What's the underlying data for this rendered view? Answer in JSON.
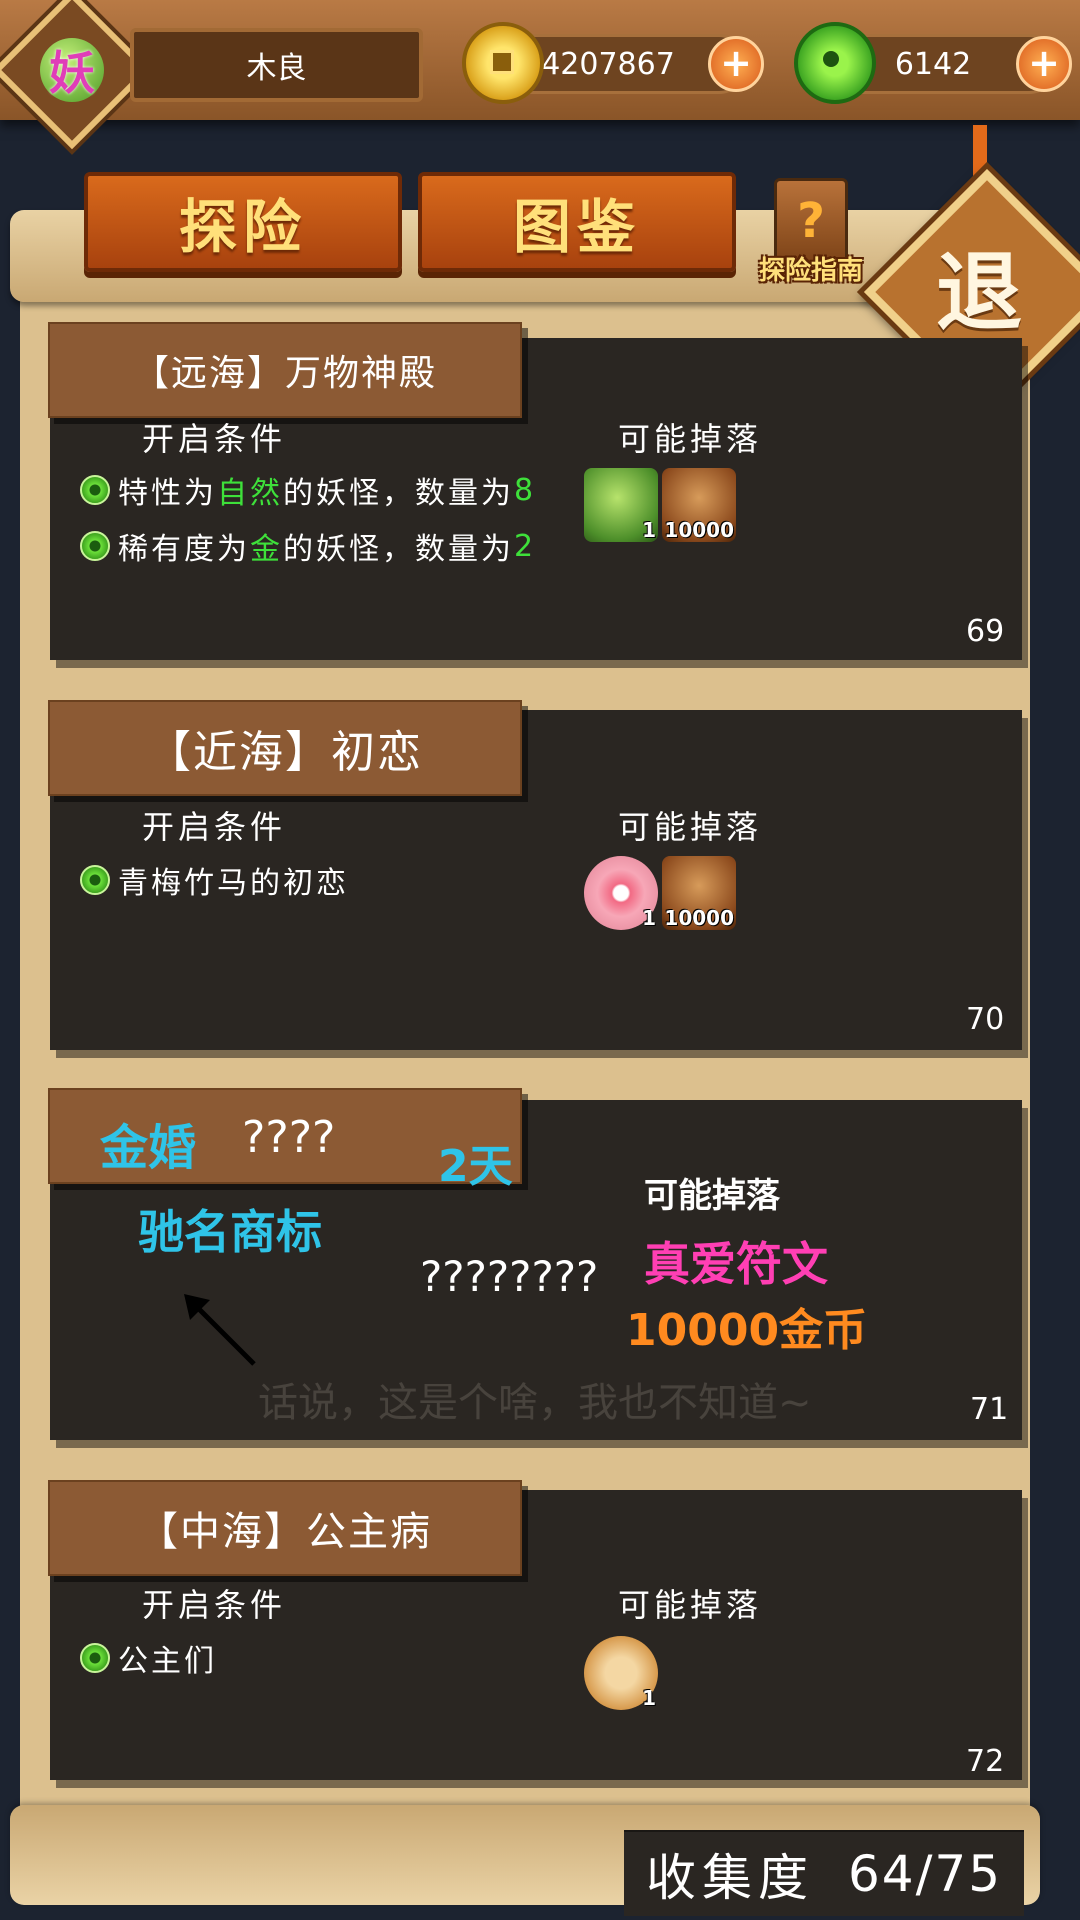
{
  "header": {
    "avatar_char": "妖",
    "player_name": "木良",
    "coins": "4207867",
    "jade": "6142",
    "plus_symbol": "+"
  },
  "tabs": [
    {
      "label": "探险",
      "active": true
    },
    {
      "label": "图鉴",
      "active": false
    }
  ],
  "guide": {
    "icon_char": "?",
    "label": "探险指南"
  },
  "exit": {
    "label": "退"
  },
  "levels": [
    {
      "title": "【远海】万物神殿",
      "conditions_header": "开启条件",
      "drops_header": "可能掉落",
      "conditions": [
        {
          "pre": "特性为",
          "hl": "自然",
          "mid": "的妖怪，数量为",
          "num": "8"
        },
        {
          "pre": "稀有度为",
          "hl": "金",
          "mid": "的妖怪，数量为",
          "num": "2"
        }
      ],
      "drops": [
        {
          "icon": "green-orb-icon",
          "count": "1"
        },
        {
          "icon": "money-bag-icon",
          "count": "10000"
        }
      ],
      "number": "69"
    },
    {
      "title": "【近海】初恋",
      "conditions_header": "开启条件",
      "drops_header": "可能掉落",
      "conditions": [
        {
          "text": "青梅竹马的初恋"
        }
      ],
      "drops": [
        {
          "icon": "heart-orb-icon",
          "count": "1"
        },
        {
          "icon": "money-bag-icon",
          "count": "10000"
        }
      ],
      "number": "70"
    },
    {
      "title_cyan": "金婚",
      "title_unknown": "????",
      "days": "2天",
      "note_brand": "驰名商标",
      "conditions_unknown": "????????",
      "drops_header": "可能掉落",
      "drop_rune": "真爱符文",
      "drop_gold": "10000金币",
      "caption": "话说，这是个啥，我也不知道~",
      "number": "71"
    },
    {
      "title": "【中海】公主病",
      "conditions_header": "开启条件",
      "drops_header": "可能掉落",
      "conditions": [
        {
          "text": "公主们"
        }
      ],
      "drops": [
        {
          "icon": "fan-item-icon",
          "count": "1"
        }
      ],
      "number": "72"
    }
  ],
  "footer": {
    "collection_label": "收集度",
    "collection_value": "64/75"
  },
  "colors": {
    "highlight_green": "#3ee03a",
    "overlay_cyan": "#2fc4e8",
    "overlay_pink": "#ff3fb4",
    "overlay_orange": "#ff8a1f",
    "tab_orange": "#c85515"
  }
}
